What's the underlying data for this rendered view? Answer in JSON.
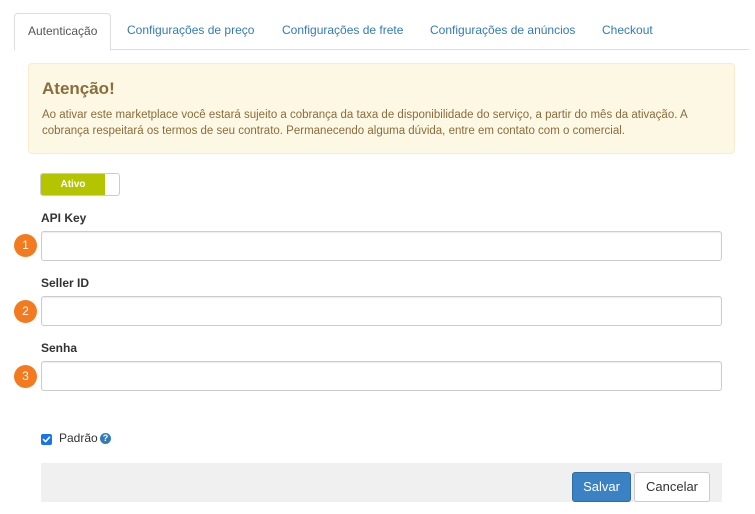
{
  "tabs": [
    {
      "label": "Autenticação",
      "active": true
    },
    {
      "label": "Configurações de preço",
      "active": false
    },
    {
      "label": "Configurações de frete",
      "active": false
    },
    {
      "label": "Configurações de anúncios",
      "active": false
    },
    {
      "label": "Checkout",
      "active": false
    }
  ],
  "alert": {
    "title": "Atenção!",
    "text": "Ao ativar este marketplace você estará sujeito a cobrança da taxa de disponibilidade do serviço, a partir do mês da ativação. A cobrança respeitará os termos de seu contrato. Permanecendo alguma dúvida, entre em contato com o comercial."
  },
  "toggle": {
    "label": "Ativo",
    "state": "on",
    "color": "#b5c400"
  },
  "fields": [
    {
      "badge": "1",
      "label": "API Key",
      "value": ""
    },
    {
      "badge": "2",
      "label": "Seller ID",
      "value": ""
    },
    {
      "badge": "3",
      "label": "Senha",
      "value": ""
    }
  ],
  "default_checkbox": {
    "label": "Padrão",
    "checked": true,
    "help_icon": "question-circle-icon"
  },
  "footer": {
    "save_label": "Salvar",
    "cancel_label": "Cancelar"
  },
  "colors": {
    "link": "#337ab7",
    "badge": "#f47a1f",
    "save_button": "#3a82c4",
    "alert_bg": "#fcf8e3",
    "alert_text": "#8a6d3b"
  }
}
